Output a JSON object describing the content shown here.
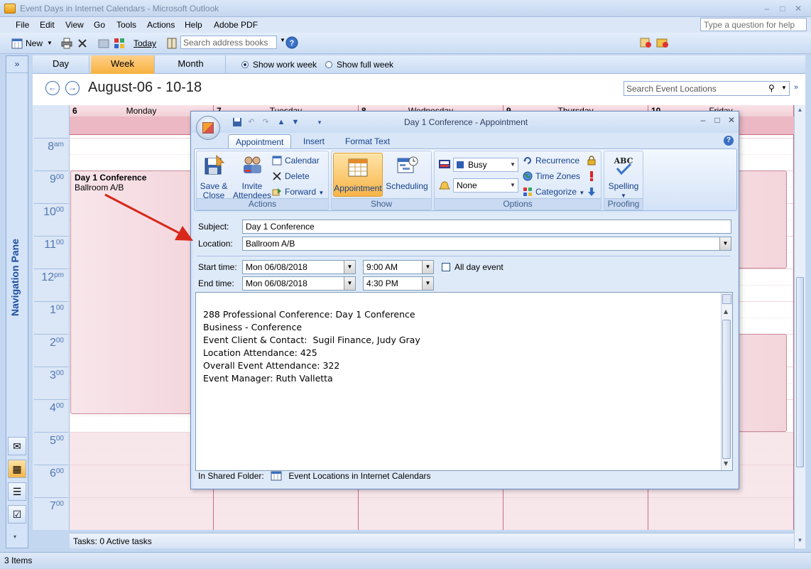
{
  "window": {
    "title": "Event Days in Internet Calendars - Microsoft Outlook",
    "minimize": "–",
    "maximize": "□",
    "close": "✕"
  },
  "menu": {
    "items": [
      "File",
      "Edit",
      "View",
      "Go",
      "Tools",
      "Actions",
      "Help",
      "Adobe PDF"
    ],
    "ask_placeholder": "Type a question for help"
  },
  "toolbar": {
    "new_label": "New",
    "today_label": "Today",
    "search_placeholder": "Search address books"
  },
  "nav_pane": {
    "expand": "»",
    "label": "Navigation Pane"
  },
  "view_tabs": {
    "day": "Day",
    "week": "Week",
    "month": "Month",
    "show_work_week": "Show work week",
    "show_full_week": "Show full week"
  },
  "calendar": {
    "date_range": "August-06 - 10-18",
    "search_placeholder": "Search Event Locations",
    "days": [
      {
        "num": "6",
        "name": "Monday"
      },
      {
        "num": "7",
        "name": "Tuesday"
      },
      {
        "num": "8",
        "name": "Wednesday"
      },
      {
        "num": "9",
        "name": "Thursday"
      },
      {
        "num": "10",
        "name": "Friday"
      }
    ],
    "hours": [
      {
        "h": "8",
        "s": "am"
      },
      {
        "h": "9",
        "s": "00"
      },
      {
        "h": "10",
        "s": "00"
      },
      {
        "h": "11",
        "s": "00"
      },
      {
        "h": "12",
        "s": "pm"
      },
      {
        "h": "1",
        "s": "00"
      },
      {
        "h": "2",
        "s": "00"
      },
      {
        "h": "3",
        "s": "00"
      },
      {
        "h": "4",
        "s": "00"
      },
      {
        "h": "5",
        "s": "00"
      },
      {
        "h": "6",
        "s": "00"
      },
      {
        "h": "7",
        "s": "00"
      }
    ],
    "appointment": {
      "title": "Day 1 Conference",
      "location": "Ballroom A/B"
    }
  },
  "tasks_bar": "Tasks: 0 Active tasks",
  "status_bar": "3 Items",
  "dialog": {
    "title": "Day 1 Conference - Appointment",
    "tabs": [
      "Appointment",
      "Insert",
      "Format Text"
    ],
    "ribbon": {
      "actions": {
        "label": "Actions",
        "save_close": [
          "Save &",
          "Close"
        ],
        "invite": [
          "Invite",
          "Attendees"
        ],
        "calendar": "Calendar",
        "delete": "Delete",
        "forward": "Forward"
      },
      "show": {
        "label": "Show",
        "appointment": "Appointment",
        "scheduling": "Scheduling"
      },
      "options": {
        "label": "Options",
        "busy": "Busy",
        "none": "None",
        "recurrence": "Recurrence",
        "time_zones": "Time Zones",
        "categorize": "Categorize"
      },
      "proofing": {
        "label": "Proofing",
        "spelling": "Spelling",
        "abc": "ABC"
      }
    },
    "form": {
      "subject_label": "Subject:",
      "subject_value": "Day 1 Conference",
      "location_label": "Location:",
      "location_value": "Ballroom A/B",
      "start_label": "Start time:",
      "start_date": "Mon 06/08/2018",
      "start_time": "9:00 AM",
      "all_day_label": "All day event",
      "end_label": "End time:",
      "end_date": "Mon 06/08/2018",
      "end_time": "4:30 PM"
    },
    "notes": [
      "288 Professional Conference: Day 1 Conference",
      "Business - Conference",
      "Event Client & Contact:  Sugil Finance, Judy Gray",
      "Location Attendance: 425",
      "Overall Event Attendance: 322",
      "Event Manager: Ruth Valletta"
    ],
    "shared_folder_label": "In Shared Folder:",
    "shared_folder_value": "Event Locations in Internet Calendars"
  },
  "colors": {
    "accent_orange": "#f7b13e",
    "calendar_pink": "#ebb8c3",
    "arrow_red": "#d8281c",
    "ribbon_blue": "#15428b"
  }
}
